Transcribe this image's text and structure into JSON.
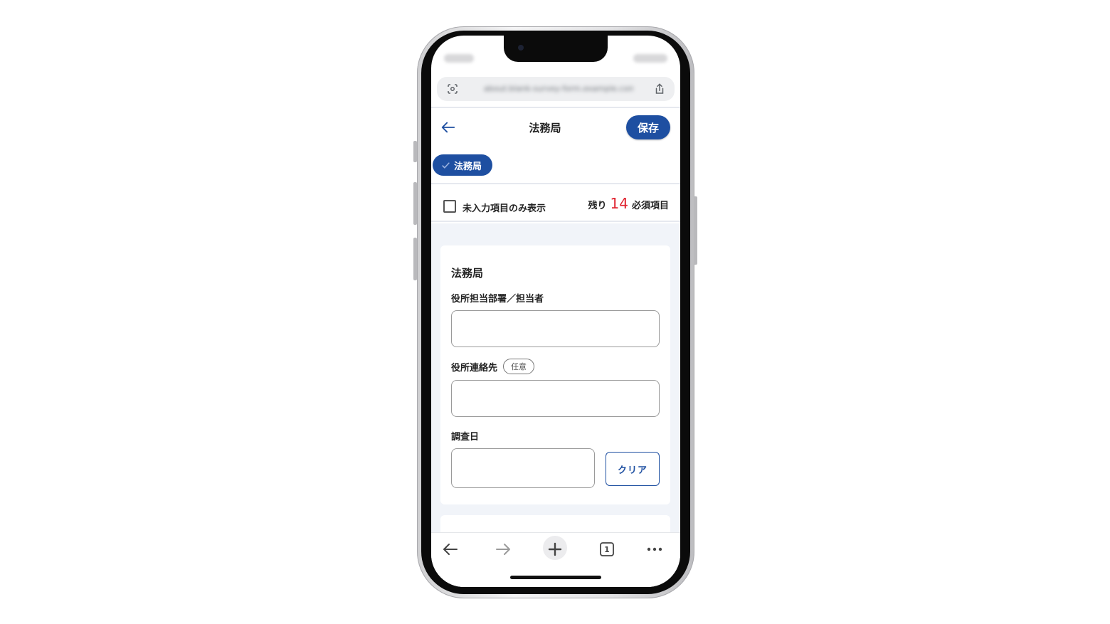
{
  "browser": {
    "url": "about:blank-survey-form.example.com",
    "tab_count": "1"
  },
  "header": {
    "title": "法務局",
    "save_label": "保存"
  },
  "chip": {
    "label": "法務局"
  },
  "filter": {
    "checkbox_label": "未入力項目のみ表示",
    "remaining_prefix": "残り",
    "remaining_count": "14",
    "remaining_suffix": "必須項目"
  },
  "form": {
    "section_title": "法務局",
    "fields": [
      {
        "label": "役所担当部署／担当者",
        "value": ""
      },
      {
        "label": "役所連絡先",
        "badge": "任意",
        "value": ""
      },
      {
        "label": "調査日",
        "value": ""
      }
    ],
    "clear_label": "クリア"
  },
  "colors": {
    "accent": "#1e4fa1",
    "count": "#e0232f",
    "background": "#f1f4f9"
  },
  "icons": {
    "back": "arrow-left-icon",
    "lens": "lens-icon",
    "share": "share-icon",
    "check": "check-icon",
    "bottom_nav": [
      "back-arrow-icon",
      "forward-arrow-icon",
      "plus-icon",
      "tabs-icon",
      "more-icon"
    ]
  }
}
